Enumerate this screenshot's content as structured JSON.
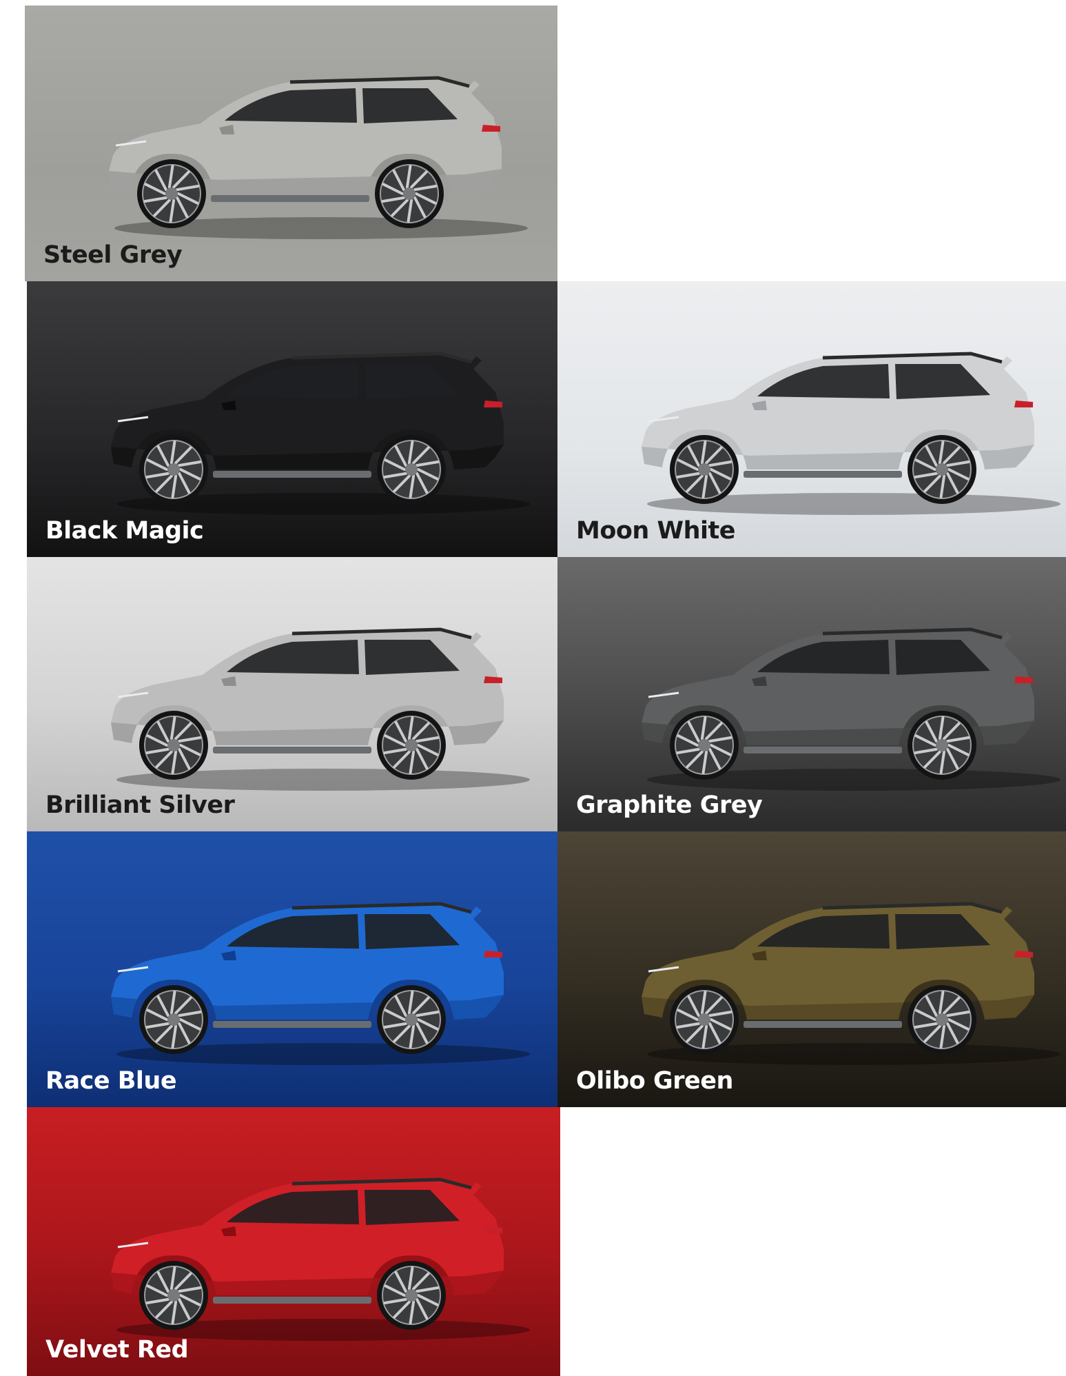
{
  "colors": [
    {
      "id": "steel",
      "name": "Steel Grey",
      "body": "#b9b9b6",
      "shade": "#8d8d8a",
      "tone": "light"
    },
    {
      "id": "black",
      "name": "Black Magic",
      "body": "#1d1d1f",
      "shade": "#0c0c0d",
      "tone": "dark"
    },
    {
      "id": "moon",
      "name": "Moon White",
      "body": "#cfd1d3",
      "shade": "#9fa2a6",
      "tone": "light"
    },
    {
      "id": "silver",
      "name": "Brilliant Silver",
      "body": "#bdbdbd",
      "shade": "#8e8e8e",
      "tone": "light"
    },
    {
      "id": "graphite",
      "name": "Graphite Grey",
      "body": "#5e5f60",
      "shade": "#3b3c3d",
      "tone": "dark"
    },
    {
      "id": "blue",
      "name": "Race Blue",
      "body": "#1f6ad2",
      "shade": "#0f3f8f",
      "tone": "dark"
    },
    {
      "id": "green",
      "name": "Olibo Green",
      "body": "#6e5f32",
      "shade": "#45391a",
      "tone": "dark"
    },
    {
      "id": "red",
      "name": "Velvet Red",
      "body": "#d11f27",
      "shade": "#8c0c12",
      "tone": "dark"
    }
  ]
}
